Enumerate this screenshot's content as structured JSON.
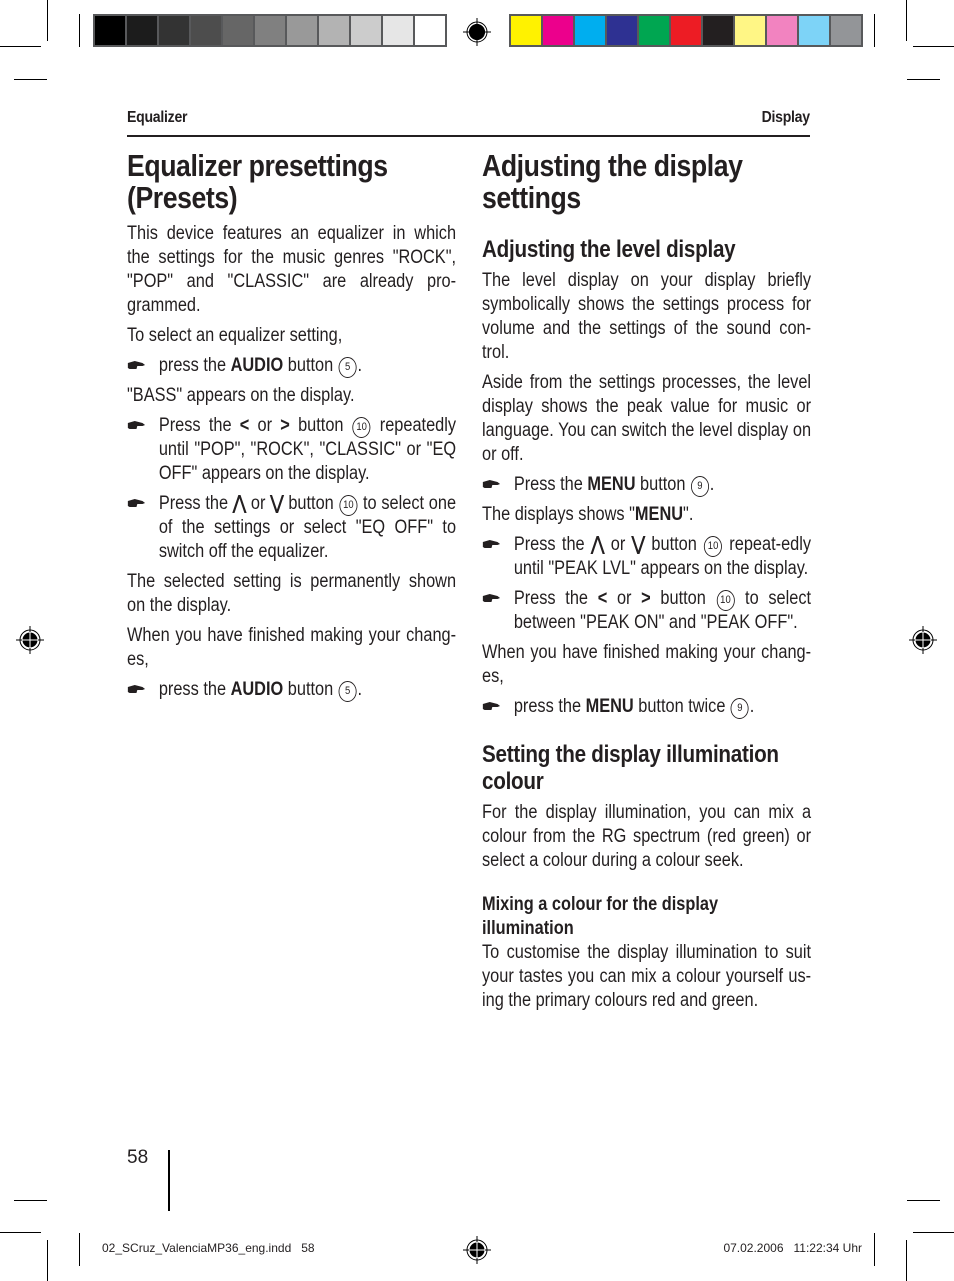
{
  "print_marks": {
    "gray_swatches": [
      "#000000",
      "#1c1c1c",
      "#333333",
      "#4d4d4d",
      "#666666",
      "#808080",
      "#999999",
      "#b3b3b3",
      "#cccccc",
      "#e6e6e6",
      "#ffffff"
    ],
    "color_swatches": [
      "#fff200",
      "#ec008c",
      "#00aeef",
      "#2e3192",
      "#00a651",
      "#ed1c24",
      "#231f20",
      "#fff685",
      "#f283c0",
      "#7dd3f7",
      "#939598"
    ]
  },
  "running_head": {
    "left": "Equalizer",
    "right": "Display"
  },
  "left_column": {
    "title": "Equalizer presettings (Presets)",
    "intro": "This device features an equalizer in which the settings for the music genres \"ROCK\", \"POP\" and \"CLASSIC\" are already pro-grammed.",
    "select_text": "To select an equalizer setting,",
    "step1": {
      "pre": "press the ",
      "bold": "AUDIO",
      "post": " button",
      "num": "5",
      "end": "."
    },
    "bass_text": "\"BASS\" appears on the display.",
    "step2": {
      "pre": "Press the ",
      "sym1": "<",
      "or": " or ",
      "sym2": ">",
      "post": " button ",
      "num": "10",
      "end": " repeatedly until \"POP\", \"ROCK\", \"CLASSIC\" or \"EQ OFF\" appears on the display."
    },
    "step3": {
      "pre": "Press the ",
      "sym1": "⋀",
      "or": " or ",
      "sym2": "⋁",
      "post": " button ",
      "num": "10",
      "end": " to select one of the settings or select \"EQ OFF\" to switch off the equalizer."
    },
    "shown_text": "The selected setting is permanently shown on the display.",
    "finished_text": "When you have finished making your chang-es,",
    "step4": {
      "pre": "press the ",
      "bold": "AUDIO",
      "post": " button",
      "num": "5",
      "end": "."
    }
  },
  "right_column": {
    "title": "Adjusting the display settings",
    "section1": {
      "heading": "Adjusting the level display",
      "para1": "The level display on your display briefly symbolically shows the settings process for volume and the settings of the sound con-trol.",
      "para2": "Aside from the settings processes, the level display shows the peak value for music or language. You can switch the level display on or off.",
      "step1": {
        "pre": "Press the ",
        "bold": "MENU",
        "post": " button",
        "num": "9",
        "end": "."
      },
      "displays_text": {
        "pre": "The displays shows \"",
        "bold": "MENU",
        "post": "\"."
      },
      "step2": {
        "pre": "Press the ",
        "sym1": "⋀",
        "or": " or ",
        "sym2": "⋁",
        "post": " button ",
        "num": "10",
        "end": " repeat-edly until \"PEAK LVL\" appears on the display."
      },
      "step3": {
        "pre": "Press the ",
        "sym1": "<",
        "or": " or ",
        "sym2": ">",
        "post": " button ",
        "num": "10",
        "end": " to select between \"PEAK ON\" and \"PEAK OFF\"."
      },
      "finished_text": "When you have finished making your chang-es,",
      "step4": {
        "pre": "press the ",
        "bold": "MENU",
        "post": " button twice",
        "num": "9",
        "end": "."
      }
    },
    "section2": {
      "heading": "Setting the display illumination colour",
      "para": "For the display illumination, you can mix a colour from the RG spectrum (red green) or select a colour during a colour seek.",
      "subheading": "Mixing a colour for the display illumination",
      "subpara": "To customise the display illumination to suit your tastes you can mix a colour yourself us-ing the primary colours red and green."
    }
  },
  "footer": {
    "page_number": "58",
    "slug_file": "02_SCruz_ValenciaMP36_eng.indd   58",
    "slug_date": "07.02.2006   11:22:34 Uhr"
  }
}
